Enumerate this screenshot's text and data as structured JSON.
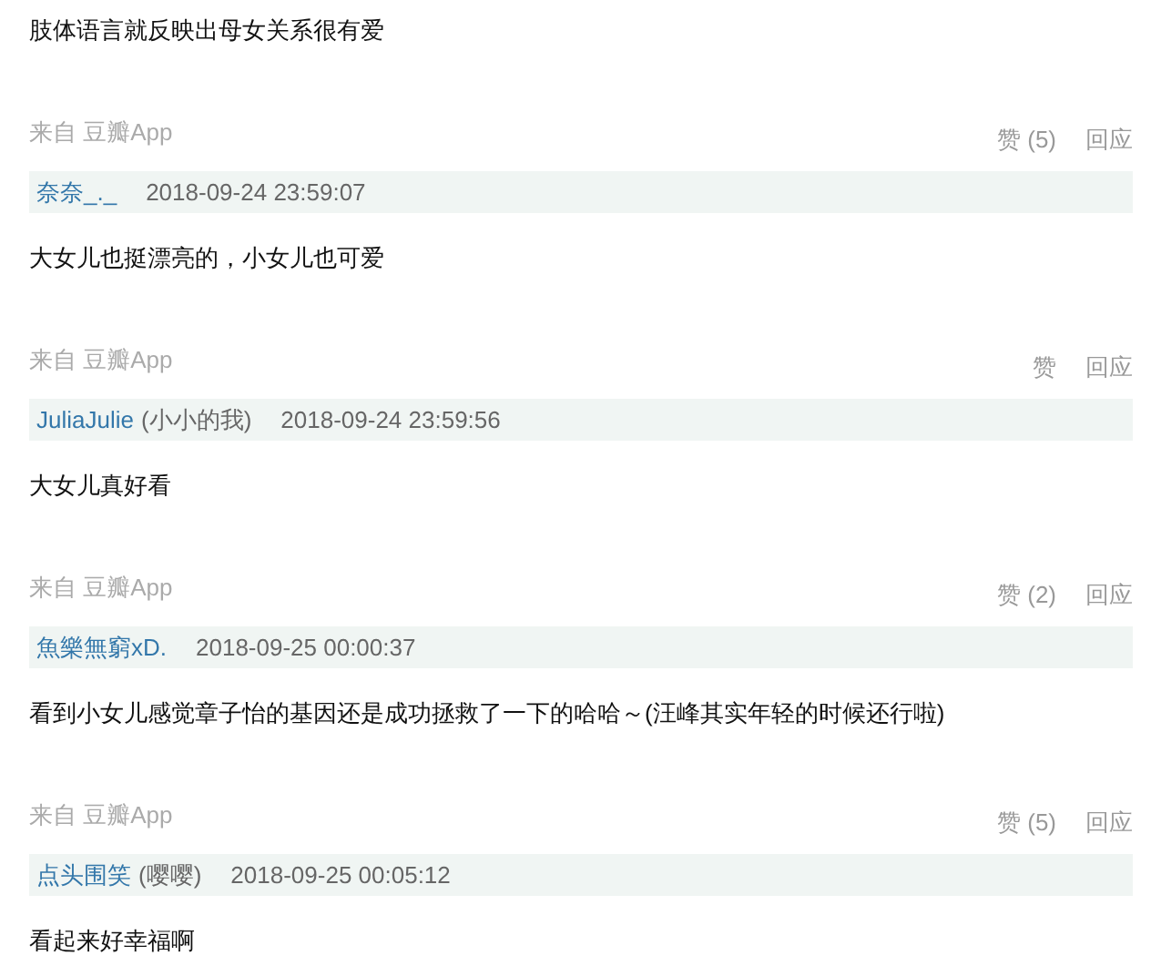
{
  "intro_text": "肢体语言就反映出母女关系很有爱",
  "comments": [
    {
      "source": "来自 豆瓣App",
      "like": "赞 (5)",
      "reply": "回应",
      "user": "奈奈_._",
      "time": "2018-09-24 23:59:07",
      "text": "大女儿也挺漂亮的，小女儿也可爱"
    },
    {
      "source": "来自 豆瓣App",
      "like": "赞",
      "reply": "回应",
      "user": "JuliaJulie",
      "nickname": "(小小的我)",
      "time": "2018-09-24 23:59:56",
      "text": "大女儿真好看"
    },
    {
      "source": "来自 豆瓣App",
      "like": "赞 (2)",
      "reply": "回应",
      "user": "魚樂無窮xD.",
      "time": "2018-09-25 00:00:37",
      "text": "看到小女儿感觉章子怡的基因还是成功拯救了一下的哈哈～(汪峰其实年轻的时候还行啦)"
    },
    {
      "source": "来自 豆瓣App",
      "like": "赞 (5)",
      "reply": "回应",
      "user": "点头围笑",
      "nickname": "(嘤嘤)",
      "time": "2018-09-25 00:05:12",
      "text": "看起来好幸福啊"
    }
  ]
}
